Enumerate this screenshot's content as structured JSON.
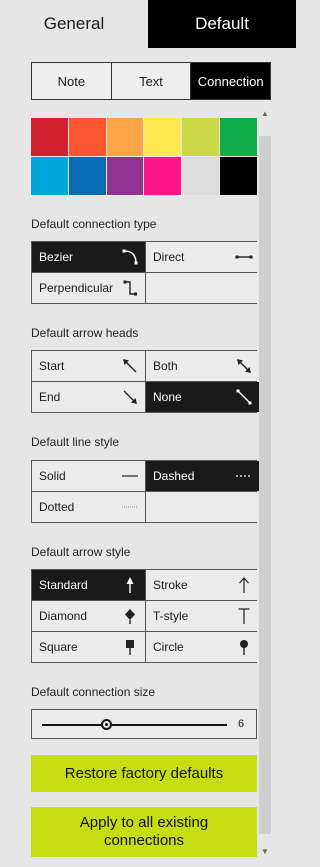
{
  "top_tabs": [
    {
      "label": "General",
      "selected": false
    },
    {
      "label": "Default",
      "selected": true
    }
  ],
  "sub_tabs": [
    {
      "label": "Note",
      "selected": false
    },
    {
      "label": "Text",
      "selected": false
    },
    {
      "label": "Connection",
      "selected": true
    }
  ],
  "colors": [
    "#d32030",
    "#fb5632",
    "#fda547",
    "#fde94f",
    "#cdd948",
    "#12ad4b",
    "#01a6dc",
    "#046bb5",
    "#913392",
    "#fe1688",
    "#dcdcdc",
    "#000000"
  ],
  "connection_type": {
    "label": "Default connection type",
    "options": [
      {
        "label": "Bezier",
        "icon": "bezier-curve-icon",
        "selected": true
      },
      {
        "label": "Direct",
        "icon": "direct-line-icon",
        "selected": false
      },
      {
        "label": "Perpendicular",
        "icon": "perpendicular-line-icon",
        "selected": false
      }
    ]
  },
  "arrow_heads": {
    "label": "Default arrow heads",
    "options": [
      {
        "label": "Start",
        "icon": "arrow-start-icon",
        "selected": false
      },
      {
        "label": "Both",
        "icon": "arrow-both-icon",
        "selected": false
      },
      {
        "label": "End",
        "icon": "arrow-end-icon",
        "selected": false
      },
      {
        "label": "None",
        "icon": "arrow-none-icon",
        "selected": true
      }
    ]
  },
  "line_style": {
    "label": "Default line style",
    "options": [
      {
        "label": "Solid",
        "icon": "solid-line-icon",
        "selected": false
      },
      {
        "label": "Dashed",
        "icon": "dashed-line-icon",
        "selected": true
      },
      {
        "label": "Dotted",
        "icon": "dotted-line-icon",
        "selected": false
      }
    ]
  },
  "arrow_style": {
    "label": "Default arrow style",
    "options": [
      {
        "label": "Standard",
        "icon": "standard-arrow-icon",
        "selected": true
      },
      {
        "label": "Stroke",
        "icon": "stroke-arrow-icon",
        "selected": false
      },
      {
        "label": "Diamond",
        "icon": "diamond-arrow-icon",
        "selected": false
      },
      {
        "label": "T-style",
        "icon": "t-style-arrow-icon",
        "selected": false
      },
      {
        "label": "Square",
        "icon": "square-arrow-icon",
        "selected": false
      },
      {
        "label": "Circle",
        "icon": "circle-arrow-icon",
        "selected": false
      }
    ]
  },
  "connection_size": {
    "label": "Default connection size",
    "value": "6",
    "fraction": 0.35
  },
  "buttons": {
    "restore": "Restore factory defaults",
    "apply": "Apply to all existing connections"
  },
  "accent": "#c8dc12"
}
